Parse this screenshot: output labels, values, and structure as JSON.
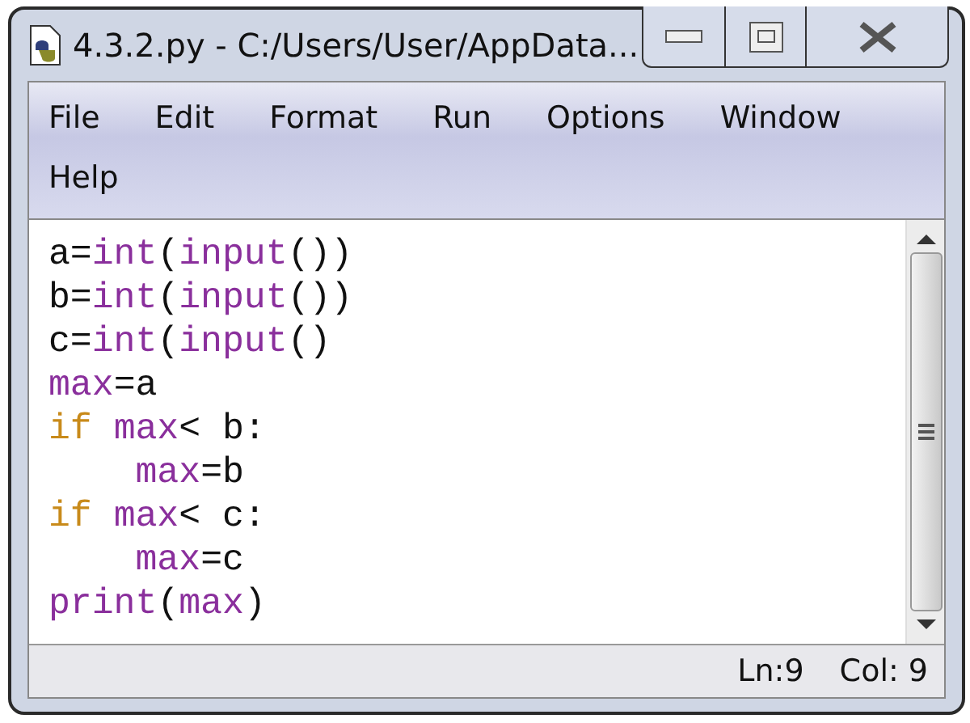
{
  "window": {
    "title": "4.3.2.py - C:/Users/User/AppData..."
  },
  "menu": [
    "File",
    "Edit",
    "Format",
    "Run",
    "Options",
    "Window",
    "Help"
  ],
  "code_lines": [
    [
      {
        "text": "a=",
        "kind": "plain"
      },
      {
        "text": "int",
        "kind": "builtin"
      },
      {
        "text": "(",
        "kind": "plain"
      },
      {
        "text": "input",
        "kind": "builtin"
      },
      {
        "text": "())",
        "kind": "plain"
      }
    ],
    [
      {
        "text": "b=",
        "kind": "plain"
      },
      {
        "text": "int",
        "kind": "builtin"
      },
      {
        "text": "(",
        "kind": "plain"
      },
      {
        "text": "input",
        "kind": "builtin"
      },
      {
        "text": "())",
        "kind": "plain"
      }
    ],
    [
      {
        "text": "c=",
        "kind": "plain"
      },
      {
        "text": "int",
        "kind": "builtin"
      },
      {
        "text": "(",
        "kind": "plain"
      },
      {
        "text": "input",
        "kind": "builtin"
      },
      {
        "text": "()",
        "kind": "plain"
      }
    ],
    [
      {
        "text": "max",
        "kind": "builtin"
      },
      {
        "text": "=a",
        "kind": "plain"
      }
    ],
    [
      {
        "text": "if ",
        "kind": "keyword"
      },
      {
        "text": "max",
        "kind": "builtin"
      },
      {
        "text": "< b:",
        "kind": "plain"
      }
    ],
    [
      {
        "text": "    max",
        "kind": "builtin"
      },
      {
        "text": "=b",
        "kind": "plain"
      }
    ],
    [
      {
        "text": "if ",
        "kind": "keyword"
      },
      {
        "text": "max",
        "kind": "builtin"
      },
      {
        "text": "< c:",
        "kind": "plain"
      }
    ],
    [
      {
        "text": "    max",
        "kind": "builtin"
      },
      {
        "text": "=c",
        "kind": "plain"
      }
    ],
    [
      {
        "text": "print",
        "kind": "builtin"
      },
      {
        "text": "(",
        "kind": "plain"
      },
      {
        "text": "max",
        "kind": "builtin"
      },
      {
        "text": ")",
        "kind": "plain"
      }
    ]
  ],
  "status_bar": {
    "line": "Ln:9",
    "column": "Col: 9"
  }
}
